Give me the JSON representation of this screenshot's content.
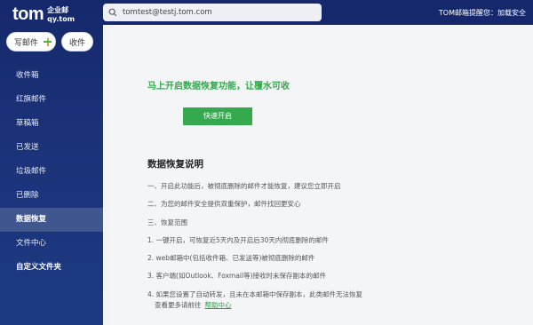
{
  "brand": {
    "logo": "tom",
    "sub1": "企业邮",
    "sub2": "qy.tom"
  },
  "actions": {
    "compose": "写邮件",
    "inbox": "收件"
  },
  "sidebar": {
    "items": [
      {
        "label": "收件箱"
      },
      {
        "label": "红旗邮件"
      },
      {
        "label": "草稿箱"
      },
      {
        "label": "已发送"
      },
      {
        "label": "垃圾邮件"
      },
      {
        "label": "已删除"
      },
      {
        "label": "数据恢复"
      },
      {
        "label": "文件中心"
      },
      {
        "label": "自定义文件夹"
      }
    ]
  },
  "search": {
    "value": "tomtest@testj.tom.com"
  },
  "header": {
    "user_info": "TOM邮箱提醒您：加载安全"
  },
  "main": {
    "headline": "马上开启数据恢复功能，让覆水可收",
    "enable_button": "快速开启",
    "section_title": "数据恢复说明",
    "lines": [
      "一、开启此功能后，被彻底删除的邮件才能恢复，建议您立即开启",
      "二、为您的邮件安全提供双重保护，邮件找回更安心",
      "三、恢复范围",
      "1. 一键开启，可恢复近5天内及开启后30天内彻底删除的邮件",
      "2. web邮箱中(包括收件箱、已发送等)被彻底删除的邮件",
      "3. 客户端(如Outlook、Foxmail等)接收时未保存副本的邮件",
      "4. 如果您设置了自动转发，且未在本邮箱中保存副本，此类邮件无法恢复"
    ],
    "more_text": "查看更多请前往",
    "help_link": "帮助中心"
  },
  "colors": {
    "sidebar": "#15286b",
    "accent_green": "#35a94d",
    "active_item": "#3f568f"
  }
}
